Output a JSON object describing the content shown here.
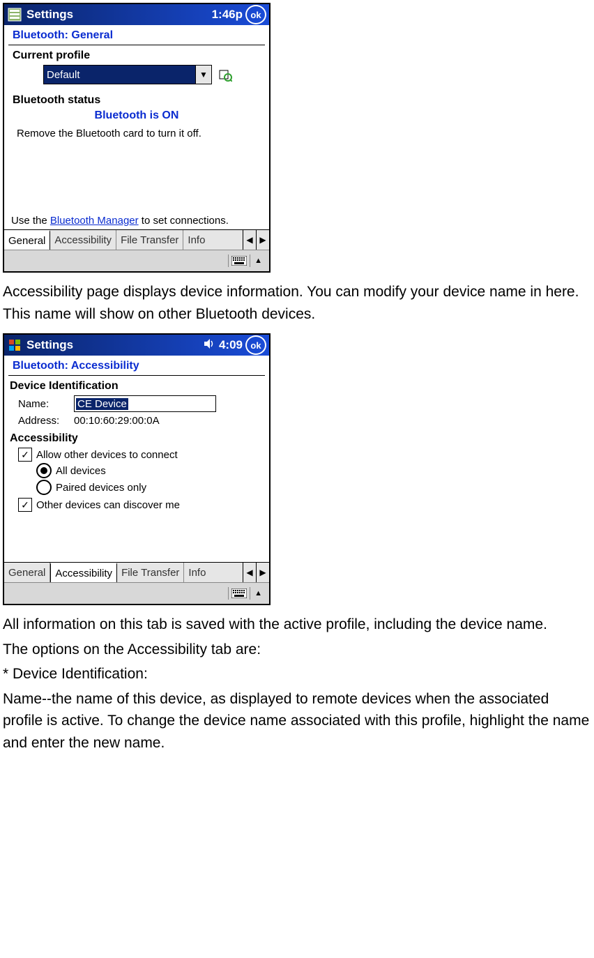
{
  "screen1": {
    "titlebar": {
      "title": "Settings",
      "clock": "1:46p",
      "ok": "ok"
    },
    "section_header": "Bluetooth: General",
    "current_profile_label": "Current profile",
    "profile_value": "Default",
    "bt_status_label": "Bluetooth status",
    "bt_status_value": "Bluetooth is ON",
    "remove_card_text": "Remove the Bluetooth card to turn it off.",
    "use_the": "Use the ",
    "bt_manager_link": "Bluetooth Manager",
    "to_set_conn": " to set connections.",
    "tabs": [
      "General",
      "Accessibility",
      "File Transfer",
      "Info"
    ]
  },
  "para1": "Accessibility page displays device information. You can modify your device name in here. This name will show on other Bluetooth devices.",
  "screen2": {
    "titlebar": {
      "title": "Settings",
      "clock": "4:09",
      "ok": "ok"
    },
    "section_header": "Bluetooth: Accessibility",
    "dev_id_label": "Device Identification",
    "name_label": "Name:",
    "name_value": "CE Device",
    "address_label": "Address:",
    "address_value": "00:10:60:29:00:0A",
    "accessibility_label": "Accessibility",
    "cb_allow": "Allow other devices to connect",
    "radio_all": "All devices",
    "radio_paired": "Paired devices only",
    "cb_discover": "Other devices can discover me",
    "tabs": [
      "General",
      "Accessibility",
      "File Transfer",
      "Info"
    ]
  },
  "para2a": "All information on this tab is saved with the active profile, including the device name.",
  "para2b": "The options on the Accessibility tab are:",
  "para2c": "* Device Identification:",
  "para2d": "Name--the name of this device, as displayed to remote devices when the associated profile is active. To change the device name associated with this profile, highlight the name and enter the new name."
}
